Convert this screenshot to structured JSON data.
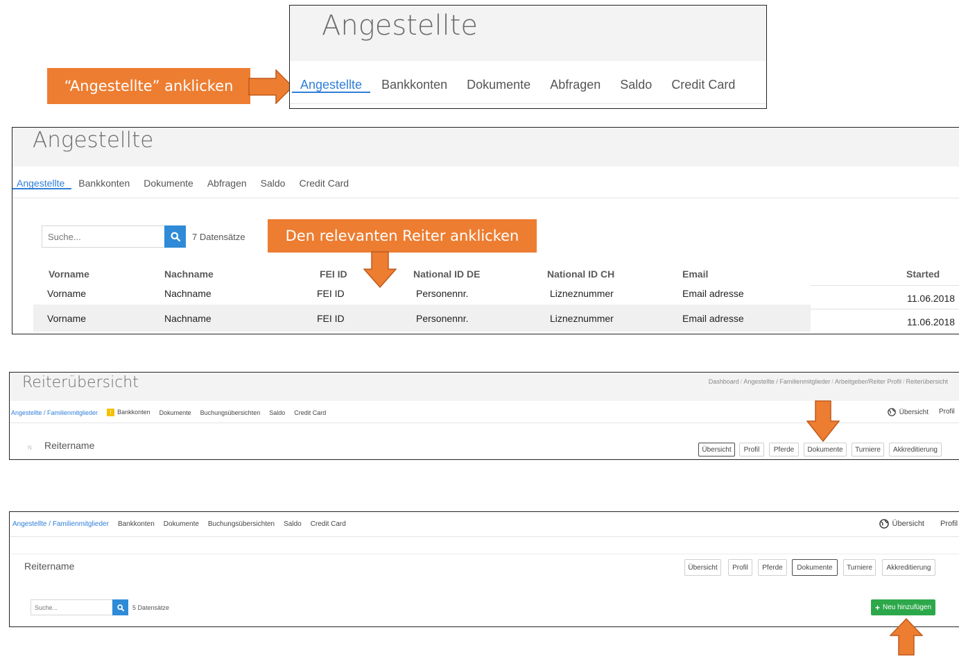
{
  "panel1": {
    "title": "Angestellte",
    "tabs": [
      "Angestellte",
      "Bankkonten",
      "Dokumente",
      "Abfragen",
      "Saldo",
      "Credit Card"
    ],
    "callout": "“Angestellte” anklicken"
  },
  "panel2": {
    "title": "Angestellte",
    "tabs": [
      "Angestellte",
      "Bankkonten",
      "Dokumente",
      "Abfragen",
      "Saldo",
      "Credit Card"
    ],
    "search_placeholder": "Suche...",
    "record_count": "7 Datensätze",
    "callout": "Den relevanten Reiter anklicken",
    "columns": [
      "Vorname",
      "Nachname",
      "FEI ID",
      "National ID DE",
      "National ID CH",
      "Email",
      "Started"
    ],
    "rows": [
      [
        "Vorname",
        "Nachname",
        "FEI ID",
        "Personennr.",
        "Lizneznummer",
        "Email adresse",
        "11.06.2018"
      ],
      [
        "Vorname",
        "Nachname",
        "FEI ID",
        "Personennr.",
        "Lizneznummer",
        "Email adresse",
        "11.06.2018"
      ]
    ]
  },
  "panel3": {
    "title": "Reiterübersicht",
    "breadcrumb": [
      "Dashboard",
      "Angestellte / Familienmitglieder",
      "Arbeitgeber/Reiter Profil",
      "Reiterübersicht"
    ],
    "tabs": [
      "Angestellte / Familienmitglieder",
      "Bankkonten",
      "Dokumente",
      "Buchungsübersichten",
      "Saldo",
      "Credit Card"
    ],
    "warning_mark": "!",
    "nav_overview": "Übersicht",
    "nav_profile": "Profil",
    "rider_name": "Reitername",
    "rider_mark": "N",
    "buttons": [
      "Übersicht",
      "Profil",
      "Pferde",
      "Dokumente",
      "Turniere",
      "Akkreditierung"
    ]
  },
  "panel4": {
    "tabs": [
      "Angestellte / Familienmitglieder",
      "Bankkonten",
      "Dokumente",
      "Buchungsübersichten",
      "Saldo",
      "Credit Card"
    ],
    "nav_overview": "Übersicht",
    "nav_profile": "Profil",
    "rider_name": "Reitername",
    "buttons": [
      "Übersicht",
      "Profil",
      "Pferde",
      "Dokumente",
      "Turniere",
      "Akkreditierung"
    ],
    "search_placeholder": "Suche...",
    "record_count": "5 Datensätze",
    "add_button": "Neu hinzufügen",
    "add_icon": "+"
  },
  "colors": {
    "callout": "#ed7d31",
    "active_tab": "#2f7ed8",
    "search_button": "#2f8bd8",
    "add_button": "#2ca84a",
    "warning": "#f6c000"
  }
}
